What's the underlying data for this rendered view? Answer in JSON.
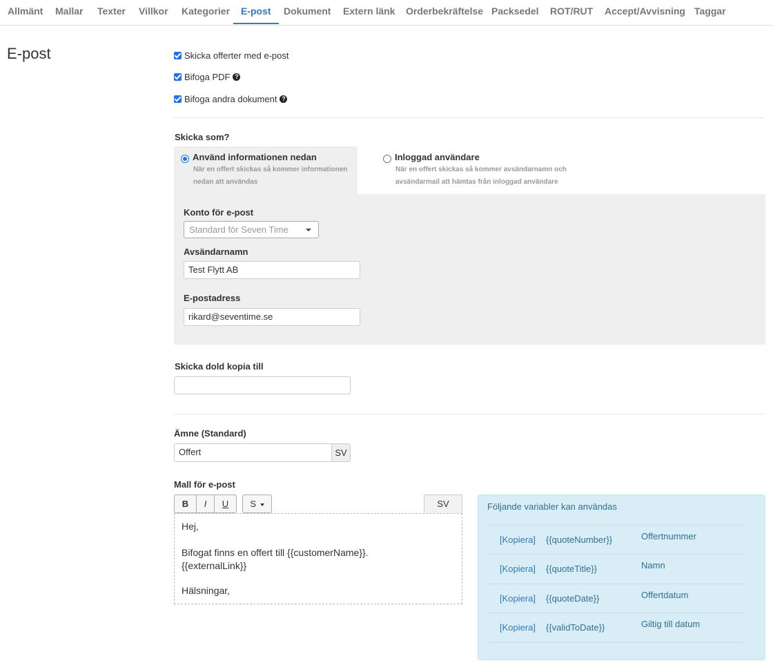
{
  "tabs": [
    {
      "label": "Allmänt"
    },
    {
      "label": "Mallar"
    },
    {
      "label": "Texter"
    },
    {
      "label": "Villkor"
    },
    {
      "label": "Kategorier"
    },
    {
      "label": "E-post",
      "active": true
    },
    {
      "label": "Dokument"
    },
    {
      "label": "Extern länk"
    },
    {
      "label": "Orderbekräftelse"
    },
    {
      "label": "Packsedel"
    },
    {
      "label": "ROT/RUT"
    },
    {
      "label": "Accept/Avvisning"
    },
    {
      "label": "Taggar"
    }
  ],
  "page_title": "E-post",
  "checkboxes": {
    "send_quotes": {
      "label": "Skicka offerter med e-post",
      "checked": true
    },
    "attach_pdf": {
      "label": "Bifoga PDF",
      "checked": true
    },
    "attach_docs": {
      "label": "Bifoga andra dokument",
      "checked": true
    }
  },
  "send_as": {
    "label": "Skicka som?",
    "option_info": {
      "title": "Använd informationen nedan",
      "desc_line1": "När en offert skickas så kommer informationen",
      "desc_line2": "nedan att användas",
      "selected": true
    },
    "option_user": {
      "title": "Inloggad användare",
      "desc_line1": "När en offert skickas så kommer avsändarnamn och",
      "desc_line2": "avsändarmail att hämtas från inloggad användare",
      "selected": false
    }
  },
  "account": {
    "label": "Konto för e-post",
    "selected": "Standard för Seven Time"
  },
  "sender_name": {
    "label": "Avsändarnamn",
    "value": "Test Flytt AB"
  },
  "email": {
    "label": "E-postadress",
    "value": "rikard@seventime.se"
  },
  "bcc": {
    "label": "Skicka dold kopia till",
    "value": ""
  },
  "subject": {
    "label": "Ämne (Standard)",
    "value": "Offert",
    "lang": "SV"
  },
  "template": {
    "label": "Mall för e-post",
    "toolbar": {
      "bold": "B",
      "italic": "I",
      "underline": "U",
      "style": "S"
    },
    "lang": "SV",
    "lines": [
      "Hej,",
      "Bifogat finns en offert till {{customerName}}.",
      "{{externalLink}}",
      "Hälsningar,"
    ]
  },
  "variables": {
    "title": "Följande variabler kan användas",
    "items": [
      {
        "copy": "[Kopiera]",
        "name": "{{quoteNumber}}",
        "desc": "Offertnummer"
      },
      {
        "copy": "[Kopiera]",
        "name": "{{quoteTitle}}",
        "desc": "Namn"
      },
      {
        "copy": "[Kopiera]",
        "name": "{{quoteDate}}",
        "desc": "Offertdatum"
      },
      {
        "copy": "[Kopiera]",
        "name": "{{validToDate}}",
        "desc": "Giltig till datum"
      }
    ]
  },
  "colors": {
    "accent": "#337ab7",
    "checkbox": "#1a73e8",
    "info_bg": "#d9edf7",
    "panel_bg": "#efefef"
  }
}
